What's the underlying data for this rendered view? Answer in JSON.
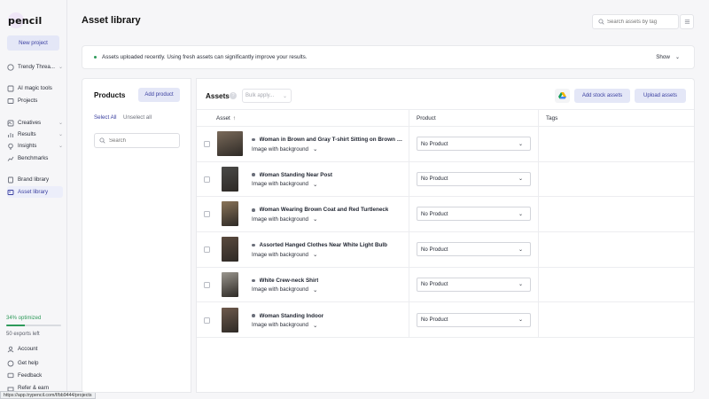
{
  "sidebar": {
    "logo_text": "pencil",
    "new_project_label": "New project",
    "workspace": "Trendy Threa...",
    "items": [
      {
        "label": "AI magic tools"
      },
      {
        "label": "Projects"
      },
      {
        "label": "Creatives"
      },
      {
        "label": "Results"
      },
      {
        "label": "Insights"
      },
      {
        "label": "Benchmarks"
      },
      {
        "label": "Brand library"
      },
      {
        "label": "Asset library"
      }
    ],
    "optimized_text": "34% optimized",
    "optimized_progress": 34,
    "exports_left": "50 exports left",
    "bottom_items": [
      {
        "label": "Account"
      },
      {
        "label": "Get help"
      },
      {
        "label": "Feedback"
      },
      {
        "label": "Refer & earn"
      }
    ]
  },
  "status_url": "https://app.trypencil.com/f/bb9444/projects",
  "header": {
    "title": "Asset library",
    "search_placeholder": "Search assets by tag"
  },
  "banner": {
    "message": "Assets uploaded recently. Using fresh assets can significantly improve your results.",
    "show_label": "Show"
  },
  "products": {
    "title": "Products",
    "add_label": "Add product",
    "select_all": "Select All",
    "unselect_all": "Unselect all",
    "search_placeholder": "Search"
  },
  "assets": {
    "title": "Assets",
    "bulk_apply_placeholder": "Bulk apply...",
    "add_stock_label": "Add stock assets",
    "upload_label": "Upload assets",
    "columns": {
      "asset": "Asset",
      "product": "Product",
      "tags": "Tags"
    },
    "rows": [
      {
        "name": "Woman in Brown and Gray T-shirt Sitting on Brown Woo...",
        "type": "Image with background",
        "product": "No Product",
        "thumb_color": "#7a6a5a"
      },
      {
        "name": "Woman Standing Near Post",
        "type": "Image with background",
        "product": "No Product",
        "thumb_color": "#4a4a48"
      },
      {
        "name": "Woman Wearing Brown Coat and Red Turtleneck",
        "type": "Image with background",
        "product": "No Product",
        "thumb_color": "#8a7458"
      },
      {
        "name": "Assorted Hanged Clothes Near White Light Bulb",
        "type": "Image with background",
        "product": "No Product",
        "thumb_color": "#5a4a3e"
      },
      {
        "name": "White Crew-neck Shirt",
        "type": "Image with background",
        "product": "No Product",
        "thumb_color": "#9a968e"
      },
      {
        "name": "Woman Standing Indoor",
        "type": "Image with background",
        "product": "No Product",
        "thumb_color": "#6e5a4c"
      }
    ]
  },
  "colors": {
    "accent": "#3a3fa0",
    "accent_bg": "#e4e7f7",
    "success": "#2e9a5a"
  }
}
